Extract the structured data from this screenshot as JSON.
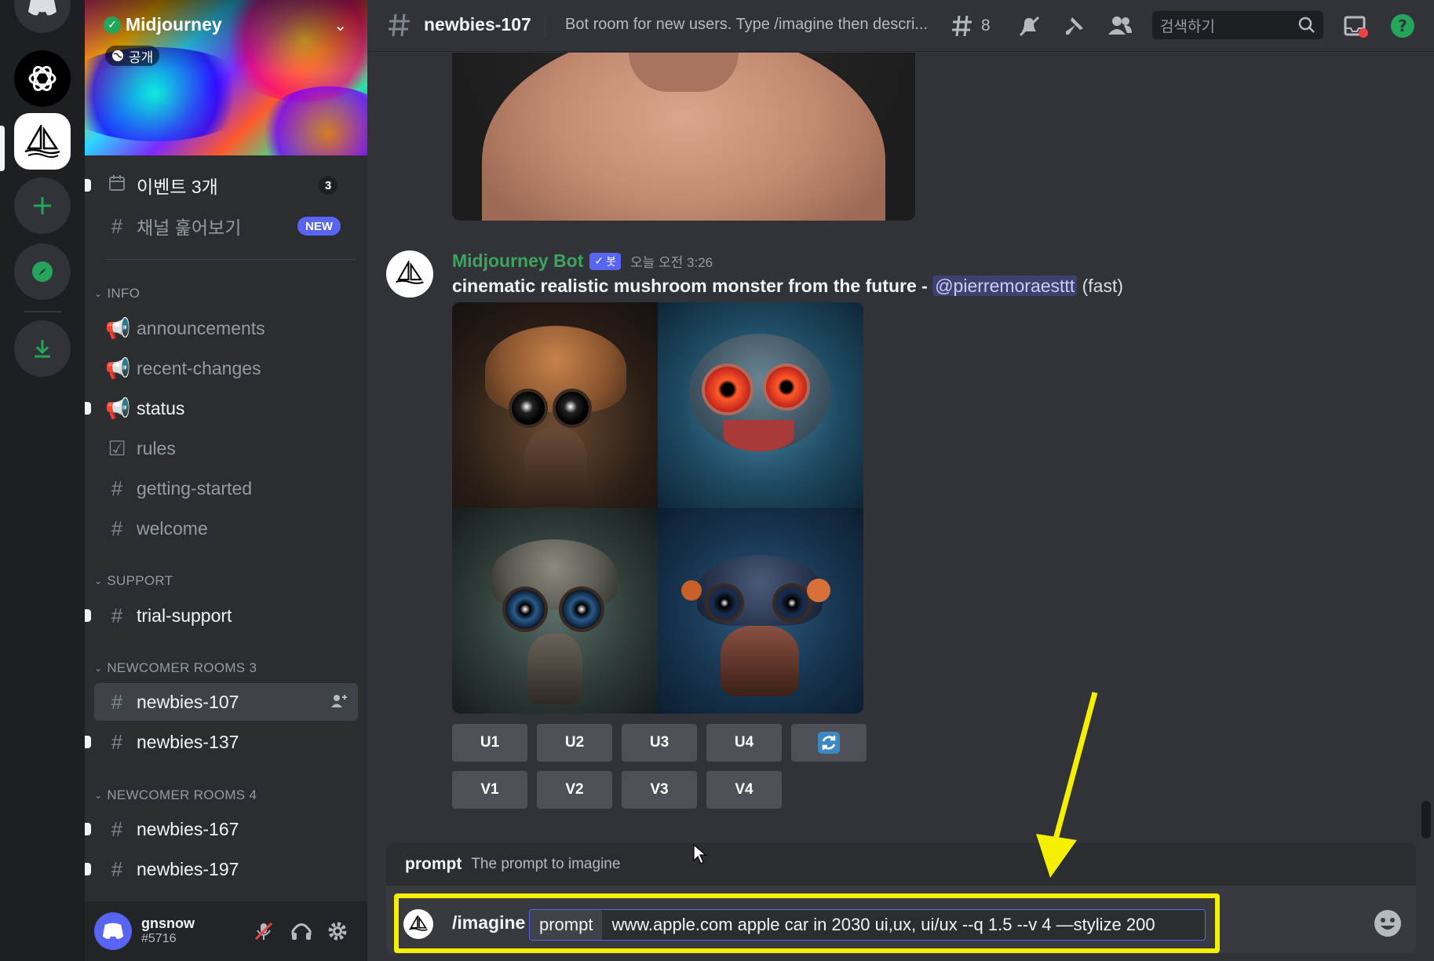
{
  "server": {
    "name": "Midjourney",
    "visibility_tag": "공개"
  },
  "sidebar": {
    "top_items": [
      {
        "label": "이벤트 3개",
        "badge": "3"
      },
      {
        "label": "채널 훑어보기",
        "badge": "NEW"
      }
    ],
    "categories": [
      {
        "label": "INFO",
        "channels": [
          "announcements",
          "recent-changes",
          "status",
          "rules",
          "getting-started",
          "welcome"
        ]
      },
      {
        "label": "SUPPORT",
        "channels": [
          "trial-support"
        ]
      },
      {
        "label": "NEWCOMER ROOMS 3",
        "channels": [
          "newbies-107",
          "newbies-137"
        ]
      },
      {
        "label": "NEWCOMER ROOMS 4",
        "channels": [
          "newbies-167",
          "newbies-197"
        ]
      }
    ]
  },
  "user": {
    "name": "gnsnow",
    "tag": "#5716"
  },
  "header": {
    "channel": "newbies-107",
    "topic": "Bot room for new users. Type /imagine then descri...",
    "threads_count": "8",
    "search_placeholder": "검색하기"
  },
  "message": {
    "author": "Midjourney Bot",
    "bot_tag": "봇",
    "timestamp": "오늘 오전 3:26",
    "prompt_text": "cinematic realistic mushroom monster from the future",
    "separator": " - ",
    "mention": "@pierremoraesttt",
    "mode": "(fast)",
    "buttons_row1": [
      "U1",
      "U2",
      "U3",
      "U4"
    ],
    "buttons_row2": [
      "V1",
      "V2",
      "V3",
      "V4"
    ]
  },
  "composer": {
    "hint_key": "prompt",
    "hint_desc": "The prompt to imagine",
    "command": "/imagine",
    "option_key": "prompt",
    "option_value": "www.apple.com apple car in 2030   ui,ux, ui/ux --q 1.5  --v 4 —stylize 200"
  },
  "colors": {
    "accent": "#5865f2",
    "online_green": "#23a55a",
    "highlight": "#f5f000",
    "bot_name": "#3ba55d"
  }
}
